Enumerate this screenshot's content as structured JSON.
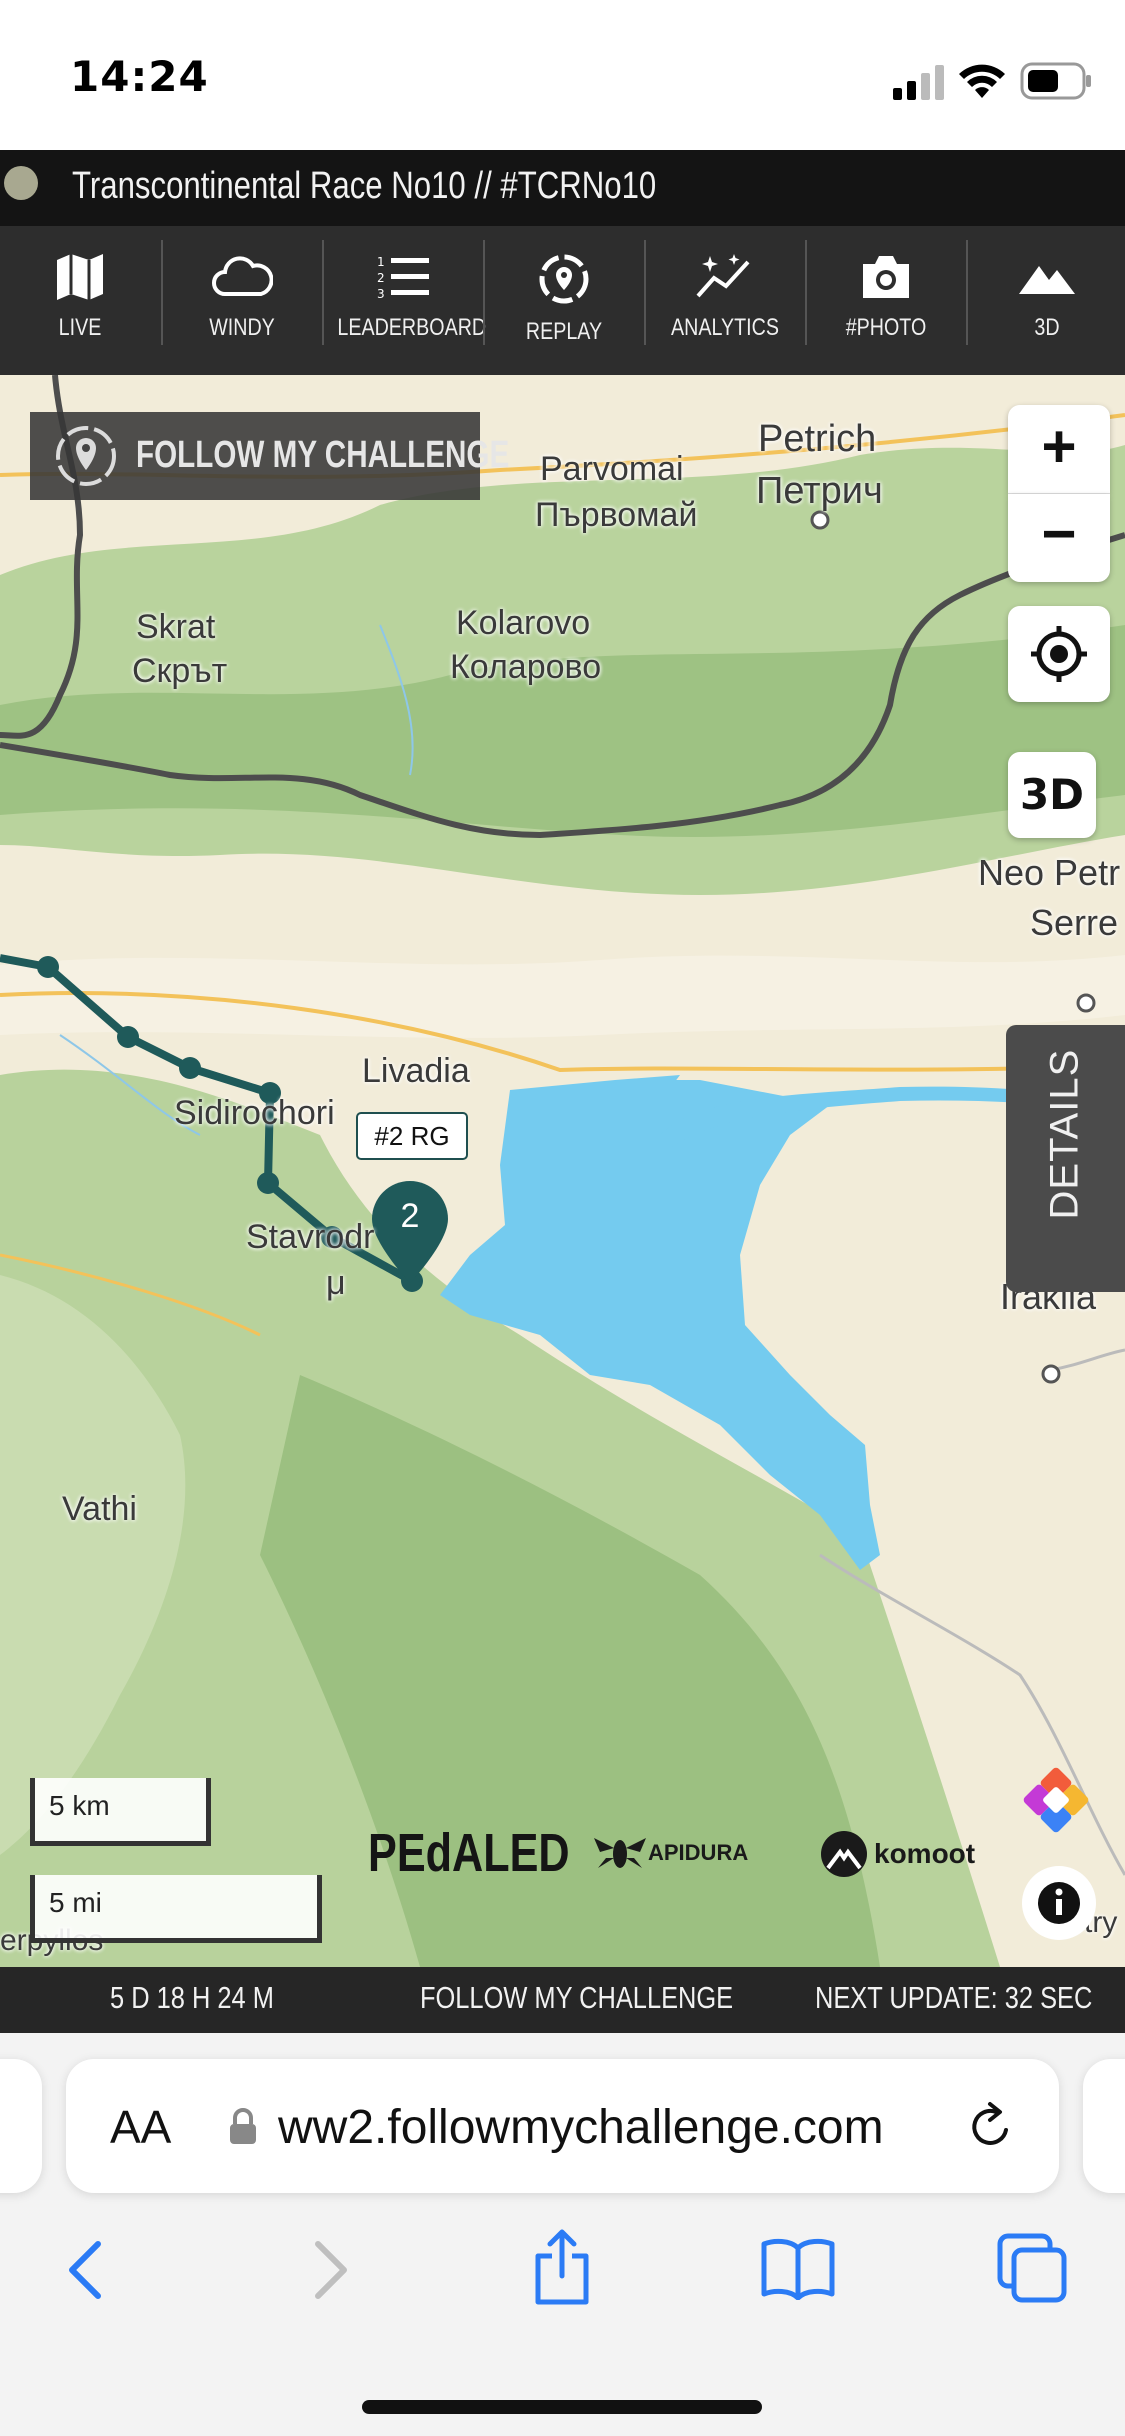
{
  "status_bar": {
    "time": "14:24"
  },
  "header": {
    "title": "Transcontinental Race No10 // #TCRNo10"
  },
  "toolbar": {
    "items": [
      {
        "label": "LIVE",
        "icon": "map-icon"
      },
      {
        "label": "WINDY",
        "icon": "cloud-icon"
      },
      {
        "label": "LEADERBOARD",
        "icon": "list-numbered-icon"
      },
      {
        "label": "REPLAY",
        "icon": "replay-icon"
      },
      {
        "label": "ANALYTICS",
        "icon": "analytics-icon"
      },
      {
        "label": "#PHOTO",
        "icon": "camera-icon"
      },
      {
        "label": "3D",
        "icon": "mountain-icon"
      }
    ]
  },
  "map": {
    "banner": "FOLLOW MY CHALLENGE",
    "places": {
      "petrich": "Petrich",
      "petrich_cyr": "Петрич",
      "parvomai": "Parvomai",
      "parvomai_cyr": "Първомай",
      "skrat": "Skrat",
      "skrat_cyr": "Скрът",
      "kolarovo": "Kolarovo",
      "kolarovo_cyr": "Коларово",
      "neo_petr": "Neo Petr",
      "serre": "Serre",
      "livadia": "Livadia",
      "sidirochori": "Sidirochori",
      "stavrodromi": "Stavrodr",
      "stavrodromi_2": "μ",
      "iraklia": "Iraklia",
      "vathi": "Vathi",
      "erpyllos": "erpyllos",
      "stry": "Stry"
    },
    "rider_label": "#2 RG",
    "rider_marker": "2",
    "controls": {
      "zoom_in": "+",
      "zoom_out": "−",
      "three_d": "3D"
    },
    "details_tab": "DETAILS",
    "scale": {
      "km": "5 km",
      "mi": "5 mi"
    },
    "sponsors": {
      "pedaled": "PEdALED",
      "apidura": "APIDURA",
      "komoot": "komoot"
    },
    "colors": {
      "route": "#1f5a5a",
      "lake": "#74cbef",
      "border": "#4d4d4d",
      "terrain": "#a6c98a"
    }
  },
  "footer": {
    "elapsed": "5 D 18 H 24 M",
    "center": "FOLLOW MY CHALLENGE",
    "next_update": "NEXT UPDATE: 32 SEC"
  },
  "safari": {
    "text_size": "AA",
    "url": "ww2.followmychallenge.com"
  }
}
